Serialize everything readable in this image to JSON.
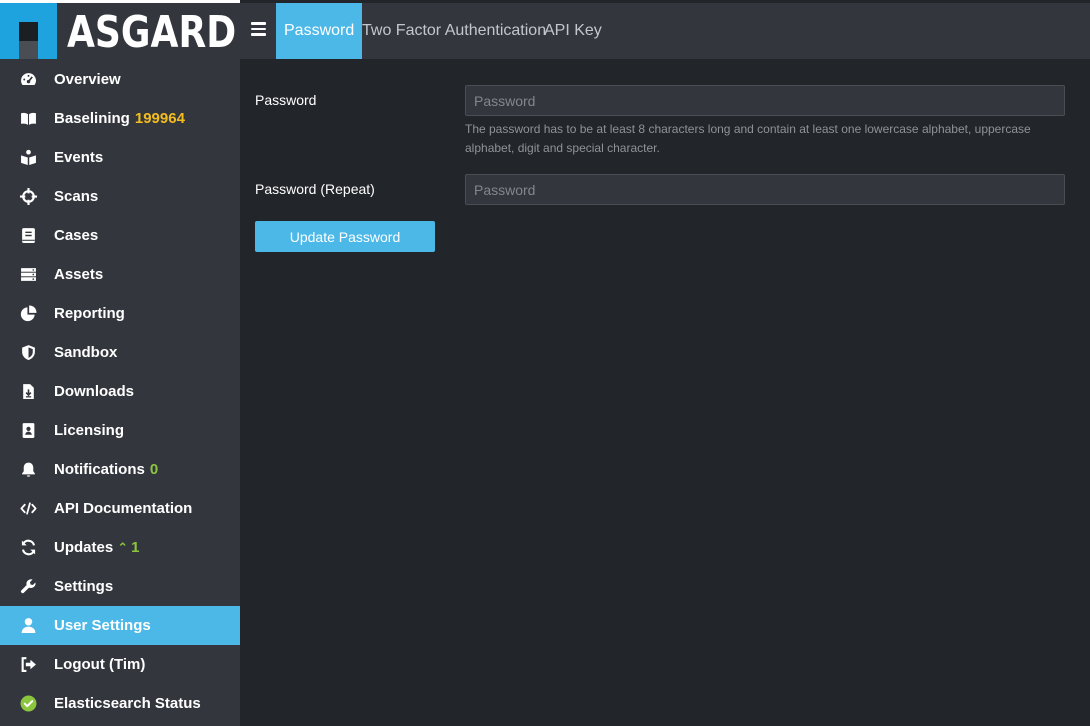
{
  "brand": {
    "name": "ASGARD"
  },
  "sidebar": {
    "items": [
      {
        "label": "Overview",
        "icon": "dashboard-icon"
      },
      {
        "label": "Baselining",
        "icon": "book-icon",
        "badge": "199964"
      },
      {
        "label": "Events",
        "icon": "events-icon"
      },
      {
        "label": "Scans",
        "icon": "crosshair-icon"
      },
      {
        "label": "Cases",
        "icon": "cases-icon"
      },
      {
        "label": "Assets",
        "icon": "server-icon"
      },
      {
        "label": "Reporting",
        "icon": "pie-chart-icon"
      },
      {
        "label": "Sandbox",
        "icon": "shield-icon"
      },
      {
        "label": "Downloads",
        "icon": "download-file-icon"
      },
      {
        "label": "Licensing",
        "icon": "license-icon"
      },
      {
        "label": "Notifications",
        "icon": "bell-icon",
        "badge": "0"
      },
      {
        "label": "API Documentation",
        "icon": "code-icon"
      },
      {
        "label": "Updates",
        "icon": "sync-icon",
        "badge": "1"
      },
      {
        "label": "Settings",
        "icon": "wrench-icon"
      },
      {
        "label": "User Settings",
        "icon": "user-icon",
        "active": true
      },
      {
        "label": "Logout (Tim)",
        "icon": "logout-icon"
      },
      {
        "label": "Elasticsearch Status",
        "icon": "check-circle-icon"
      }
    ]
  },
  "tabs": [
    {
      "label": "Password",
      "active": true
    },
    {
      "label": "Two Factor Authentication"
    },
    {
      "label": "API Key"
    }
  ],
  "form": {
    "password_label": "Password",
    "password_placeholder": "Password",
    "password_value": "",
    "help_text": "The password has to be at least 8 characters long and contain at least one lowercase alphabet, uppercase alphabet, digit and special character.",
    "repeat_label": "Password (Repeat)",
    "repeat_placeholder": "Password",
    "repeat_value": "",
    "submit_label": "Update Password"
  },
  "colors": {
    "accent": "#4bb8e8",
    "brand_blue": "#1fa3df",
    "badge_yellow": "#f3bc1f",
    "badge_green": "#8cc63f",
    "sidebar_bg": "#33373d",
    "content_bg": "#222529"
  }
}
